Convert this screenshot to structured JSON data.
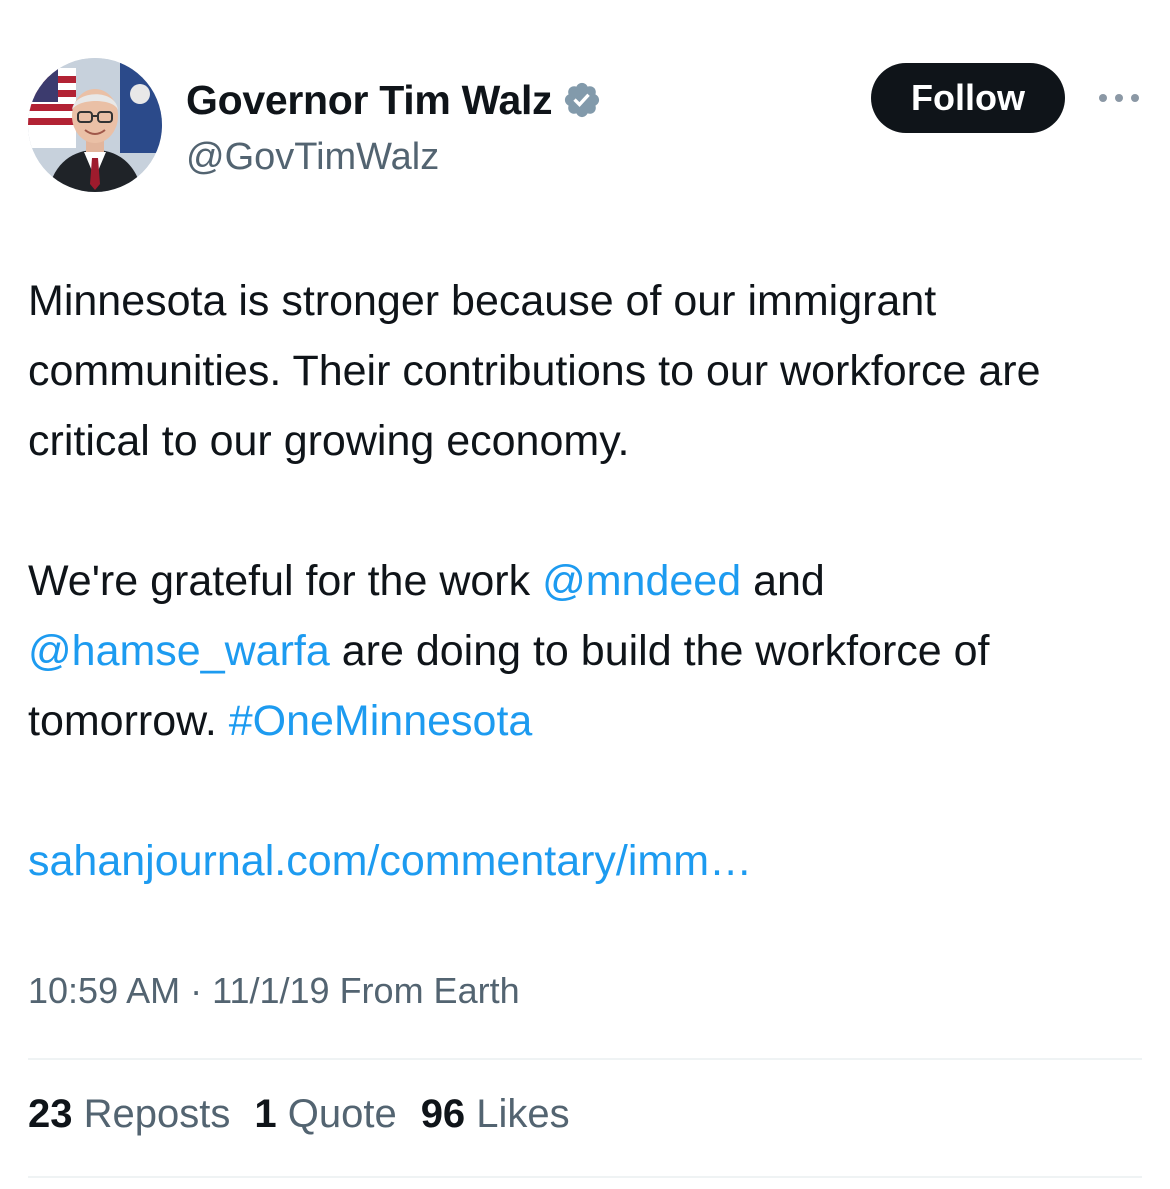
{
  "author": {
    "display_name": "Governor Tim Walz",
    "handle": "@GovTimWalz",
    "verified_icon": "verified-badge-icon",
    "verified_color": "#829aab"
  },
  "actions": {
    "follow_label": "Follow",
    "more_icon": "more-horizontal-icon"
  },
  "tweet": {
    "para1": "Minnesota is stronger because of our immigrant communities. Their contributions to our workforce are critical to our growing economy.",
    "para2_a": "We're grateful for the work ",
    "mention1": "@mndeed",
    "para2_b": " and ",
    "mention2": "@hamse_warfa",
    "para2_c": " are doing to build the workforce of tomorrow. ",
    "hashtag": "#OneMinnesota",
    "url": "sahanjournal.com/commentary/imm…"
  },
  "meta": {
    "time": "10:59 AM",
    "separator": " · ",
    "date": "11/1/19",
    "source": " From Earth"
  },
  "stats": {
    "reposts_count": "23",
    "reposts_label": " Reposts",
    "quotes_count": "1",
    "quotes_label": " Quote",
    "likes_count": "96",
    "likes_label": " Likes"
  },
  "colors": {
    "link": "#1d9bf0",
    "text": "#0f1419",
    "secondary": "#536471",
    "button_bg": "#0f1419"
  }
}
